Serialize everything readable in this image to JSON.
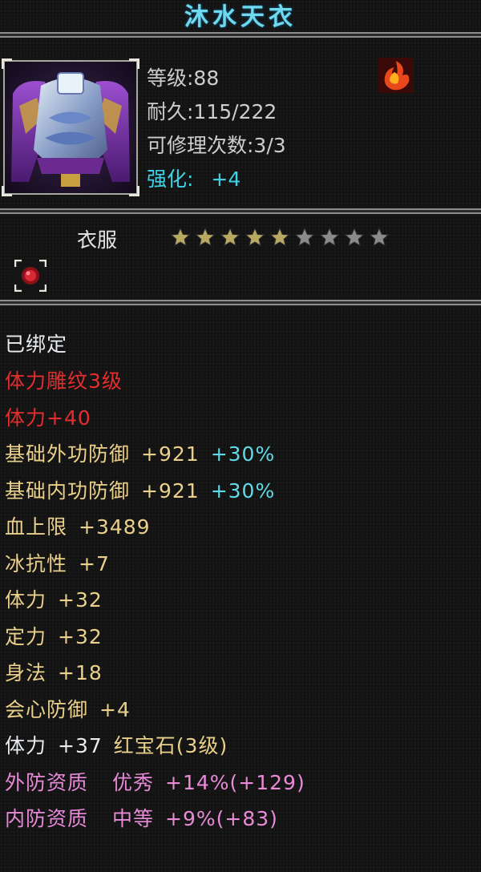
{
  "item": {
    "name": "沐水天衣",
    "level": "等级:88",
    "durability": "耐久:115/222",
    "repairs": "可修理次数:3/3",
    "enhance_label": "强化:",
    "enhance_value": "+4",
    "type": "衣服",
    "stars_filled": 5,
    "stars_total": 9
  },
  "colors": {
    "title": "#6fd9ee",
    "star_filled": "#b9a862",
    "star_empty": "#8a8a8a",
    "red": "#e62c2c",
    "gold": "#ead08a",
    "cyan": "#5fdbe8",
    "pink": "#e88ad8"
  },
  "icons": {
    "item_icon": "armor-robe-icon",
    "element_icon": "fire-element-icon",
    "gem_slot": "ruby-gem-slot-icon"
  },
  "attributes": {
    "bound": "已绑定",
    "engrave": "体力雕纹3级",
    "engrave_bonus": "体力+40",
    "phys_def": {
      "label": "基础外功防御",
      "value": "+921",
      "pct": "+30%"
    },
    "inner_def": {
      "label": "基础内功防御",
      "value": "+921",
      "pct": "+30%"
    },
    "hp": {
      "label": "血上限",
      "value": "+3489"
    },
    "ice_res": {
      "label": "冰抗性",
      "value": "+7"
    },
    "stamina": {
      "label": "体力",
      "value": "+32"
    },
    "focus": {
      "label": "定力",
      "value": "+32"
    },
    "agility": {
      "label": "身法",
      "value": "+18"
    },
    "crit_def": {
      "label": "会心防御",
      "value": "+4"
    },
    "gem": {
      "label": "体力",
      "value": "+37",
      "gem_name": "红宝石(3级)"
    },
    "outer_quality": {
      "label": "外防资质",
      "grade": "优秀",
      "value": "+14%(+129)"
    },
    "inner_quality": {
      "label": "内防资质",
      "grade": "中等",
      "value": "+9%(+83)"
    }
  }
}
